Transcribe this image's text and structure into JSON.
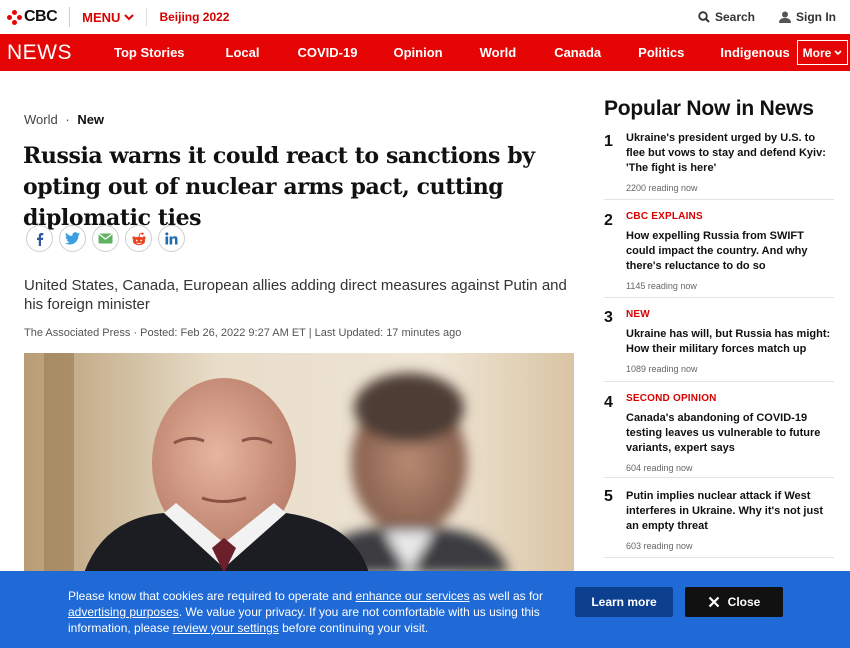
{
  "header": {
    "logo": "CBC",
    "menu_label": "MENU",
    "event_link": "Beijing 2022",
    "search_label": "Search",
    "signin_label": "Sign In"
  },
  "nav": {
    "section": "NEWS",
    "items": [
      "Top Stories",
      "Local",
      "COVID-19",
      "Opinion",
      "World",
      "Canada",
      "Politics",
      "Indigenous"
    ],
    "more_label": "More"
  },
  "article": {
    "breadcrumb_section": "World",
    "breadcrumb_sep": "·",
    "breadcrumb_tag": "New",
    "headline": "Russia warns it could react to sanctions by opting out of nuclear arms pact, cutting diplomatic ties",
    "deck": "United States, Canada, European allies adding direct measures against Putin and his foreign minister",
    "byline": "The Associated Press · Posted: Feb 26, 2022 9:27 AM ET | Last Updated: 17 minutes ago",
    "share_icons": [
      "facebook-icon",
      "twitter-icon",
      "email-icon",
      "reddit-icon",
      "linkedin-icon"
    ]
  },
  "sidebar": {
    "title": "Popular Now in News",
    "items": [
      {
        "num": "1",
        "label": "",
        "text": "Ukraine's president urged by U.S. to flee but vows to stay and defend Kyiv: 'The fight is here'",
        "reads": "2200 reading now"
      },
      {
        "num": "2",
        "label": "CBC EXPLAINS",
        "text": "How expelling Russia from SWIFT could impact the country. And why there's reluctance to do so",
        "reads": "1145 reading now"
      },
      {
        "num": "3",
        "label": "NEW",
        "text": "Ukraine has will, but Russia has might: How their military forces match up",
        "reads": "1089 reading now"
      },
      {
        "num": "4",
        "label": "SECOND OPINION",
        "text": "Canada's abandoning of COVID-19 testing leaves us vulnerable to future variants, expert says",
        "reads": "604 reading now"
      },
      {
        "num": "5",
        "label": "",
        "text": "Putin implies nuclear attack if West interferes in Ukraine. Why it's not just an empty threat",
        "reads": "603 reading now"
      }
    ]
  },
  "cookie": {
    "t1": "Please know that cookies are required to operate and ",
    "link1": "enhance our services",
    "t2": " as well as for ",
    "link2": "advertising purposes",
    "t3": ". We value your privacy. If you are not comfortable with us using this information, please ",
    "link3": "review your settings",
    "t4": " before continuing your visit.",
    "learn_more": "Learn more",
    "close": "Close"
  },
  "colors": {
    "brand_red": "#e60505",
    "banner_blue": "#1f6ad6",
    "learn_more_bg": "#0d3f8f"
  }
}
